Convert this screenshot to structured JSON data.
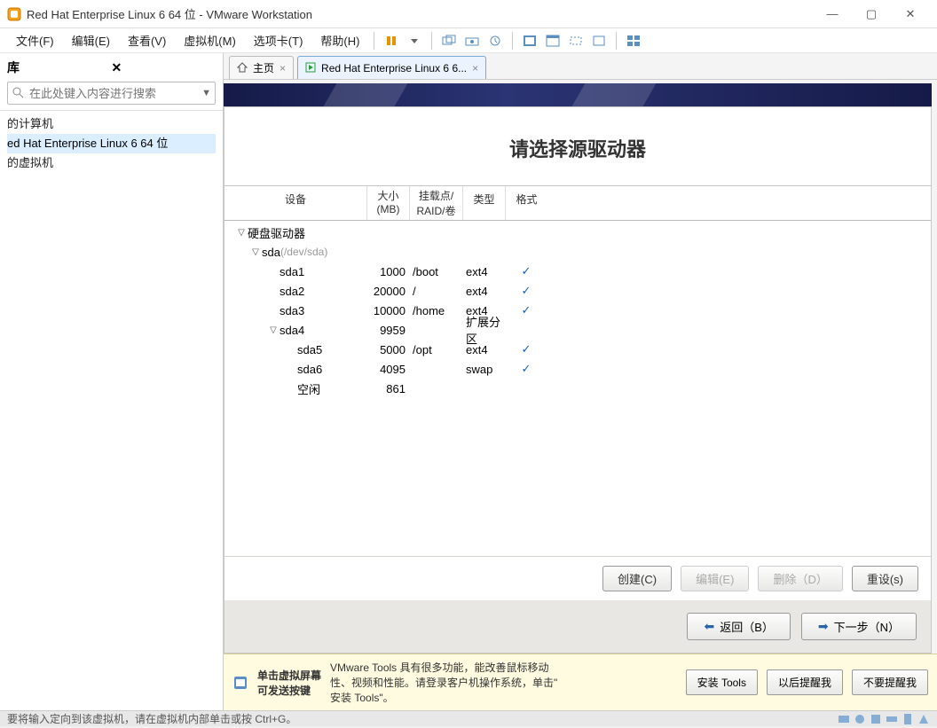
{
  "window": {
    "title": "Red Hat Enterprise Linux 6 64 位 - VMware Workstation"
  },
  "menu": {
    "file": "文件(F)",
    "edit": "编辑(E)",
    "view": "查看(V)",
    "vm": "虚拟机(M)",
    "tabs": "选项卡(T)",
    "help": "帮助(H)"
  },
  "sidebar": {
    "title": "库",
    "search_placeholder": "在此处键入内容进行搜索",
    "tree": {
      "root": "的计算机",
      "vm": "ed Hat Enterprise Linux 6 64 位",
      "shared": "的虚拟机"
    }
  },
  "tabs": {
    "home": "主页",
    "vm": "Red Hat Enterprise Linux 6 6..."
  },
  "installer": {
    "title": "请选择源驱动器",
    "headers": {
      "device": "设备",
      "size": "大小\n(MB)",
      "mount": "挂载点/\nRAID/卷",
      "type": "类型",
      "format": "格式"
    },
    "rows": [
      {
        "lvl": 1,
        "tri": "▽",
        "dev": "硬盘驱动器",
        "size": "",
        "mount": "",
        "type": "",
        "fmt": false
      },
      {
        "lvl": 2,
        "tri": "▽",
        "dev": "sda",
        "dim": "(/dev/sda)",
        "size": "",
        "mount": "",
        "type": "",
        "fmt": false
      },
      {
        "lvl": 3,
        "tri": "",
        "dev": "sda1",
        "size": "1000",
        "mount": "/boot",
        "type": "ext4",
        "fmt": true
      },
      {
        "lvl": 3,
        "tri": "",
        "dev": "sda2",
        "size": "20000",
        "mount": "/",
        "type": "ext4",
        "fmt": true
      },
      {
        "lvl": 3,
        "tri": "",
        "dev": "sda3",
        "size": "10000",
        "mount": "/home",
        "type": "ext4",
        "fmt": true
      },
      {
        "lvl": 3,
        "tri": "▽",
        "dev": "sda4",
        "size": "9959",
        "mount": "",
        "type": "扩展分区",
        "fmt": false
      },
      {
        "lvl": 4,
        "tri": "",
        "dev": "sda5",
        "size": "5000",
        "mount": "/opt",
        "type": "ext4",
        "fmt": true
      },
      {
        "lvl": 4,
        "tri": "",
        "dev": "sda6",
        "size": "4095",
        "mount": "",
        "type": "swap",
        "fmt": true
      },
      {
        "lvl": 4,
        "tri": "",
        "dev": "空闲",
        "size": "861",
        "mount": "",
        "type": "",
        "fmt": false
      }
    ],
    "buttons": {
      "create": "创建(C)",
      "edit": "编辑(E)",
      "del": "删除（D）",
      "reset": "重设(s)"
    },
    "nav": {
      "back": "返回（B）",
      "next": "下一步（N）"
    }
  },
  "hint": {
    "t1": "单击虚拟屏幕\n可发送按键",
    "t2": "VMware Tools 具有很多功能，能改善鼠标移动\n性、视频和性能。请登录客户机操作系统，单击\"\n安装 Tools\"。",
    "install": "安装 Tools",
    "later": "以后提醒我",
    "never": "不要提醒我"
  },
  "status": {
    "text": "要将输入定向到该虚拟机，请在虚拟机内部单击或按 Ctrl+G。"
  }
}
